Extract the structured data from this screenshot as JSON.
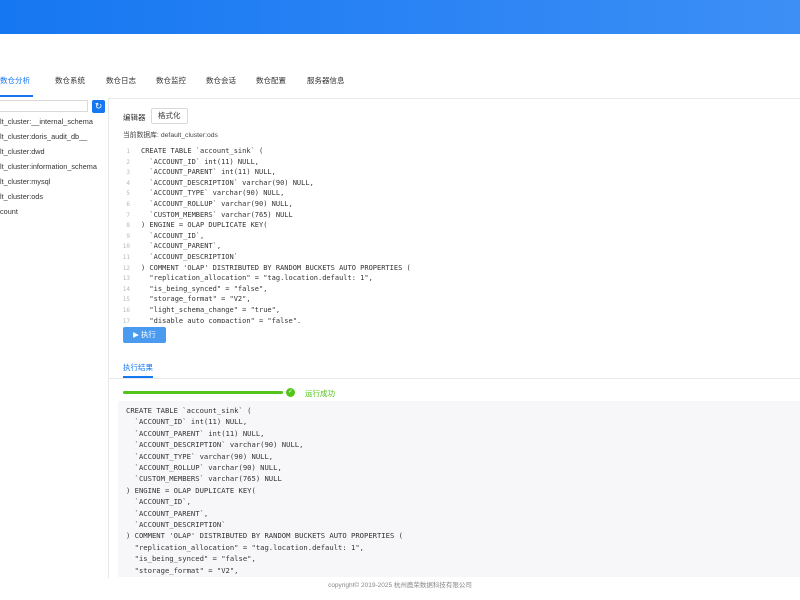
{
  "tabs": [
    {
      "label": "数仓分析",
      "active": true
    },
    {
      "label": "数仓系统",
      "active": false
    },
    {
      "label": "数仓日志",
      "active": false
    },
    {
      "label": "数仓监控",
      "active": false
    },
    {
      "label": "数仓会话",
      "active": false
    },
    {
      "label": "数仓配置",
      "active": false
    },
    {
      "label": "服务器信息",
      "active": false
    }
  ],
  "sidebar": {
    "items": [
      "lt_cluster:__internal_schema",
      "lt_cluster:doris_audit_db__",
      "lt_cluster:dwd",
      "lt_cluster:information_schema",
      "lt_cluster:mysql",
      "lt_cluster:ods",
      "count"
    ]
  },
  "editor": {
    "label": "编辑器",
    "format_button": "格式化",
    "db_label": "当前数据库:",
    "db_value": "default_cluster:ods",
    "run_button": "执行",
    "lines": [
      "CREATE TABLE `account_sink` (",
      "  `ACCOUNT_ID` int(11) NULL,",
      "  `ACCOUNT_PARENT` int(11) NULL,",
      "  `ACCOUNT_DESCRIPTION` varchar(90) NULL,",
      "  `ACCOUNT_TYPE` varchar(90) NULL,",
      "  `ACCOUNT_ROLLUP` varchar(90) NULL,",
      "  `CUSTOM_MEMBERS` varchar(765) NULL",
      ") ENGINE = OLAP DUPLICATE KEY(",
      "  `ACCOUNT_ID`,",
      "  `ACCOUNT_PARENT`,",
      "  `ACCOUNT_DESCRIPTION`",
      ") COMMENT 'OLAP' DISTRIBUTED BY RANDOM BUCKETS AUTO PROPERTIES (",
      "  \"replication_allocation\" = \"tag.location.default: 1\",",
      "  \"is_being_synced\" = \"false\",",
      "  \"storage_format\" = \"V2\",",
      "  \"light_schema_change\" = \"true\",",
      "  \"disable_auto_compaction\" = \"false\","
    ]
  },
  "result": {
    "tab_label": "执行结果",
    "progress": 1.0,
    "status_text": "运行成功",
    "lines": [
      "CREATE TABLE `account_sink` (",
      "  `ACCOUNT_ID` int(11) NULL,",
      "  `ACCOUNT_PARENT` int(11) NULL,",
      "  `ACCOUNT_DESCRIPTION` varchar(90) NULL,",
      "  `ACCOUNT_TYPE` varchar(90) NULL,",
      "  `ACCOUNT_ROLLUP` varchar(90) NULL,",
      "  `CUSTOM_MEMBERS` varchar(765) NULL",
      ") ENGINE = OLAP DUPLICATE KEY(",
      "  `ACCOUNT_ID`,",
      "  `ACCOUNT_PARENT`,",
      "  `ACCOUNT_DESCRIPTION`",
      ") COMMENT 'OLAP' DISTRIBUTED BY RANDOM BUCKETS AUTO PROPERTIES (",
      "  \"replication_allocation\" = \"tag.location.default: 1\",",
      "  \"is_being_synced\" = \"false\",",
      "  \"storage_format\" = \"V2\","
    ]
  },
  "footer": "copyright© 2019-2025 杭州鹿荣数据科技有限公司",
  "colors": {
    "accent": "#1677f2",
    "success": "#52c41a"
  }
}
